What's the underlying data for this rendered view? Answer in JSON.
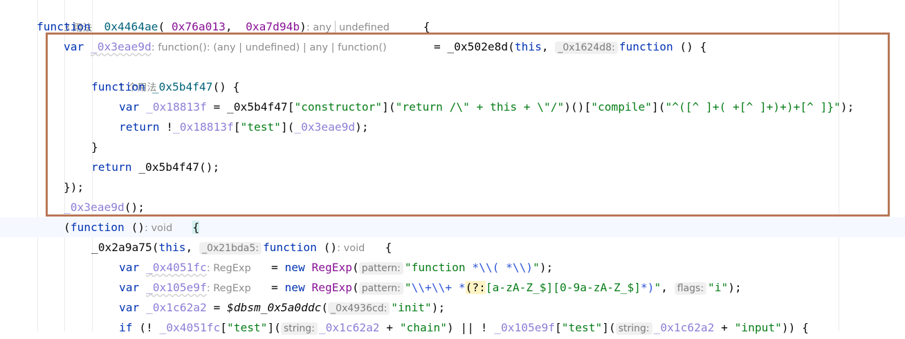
{
  "editor": {
    "usages_3": "3 用法",
    "usages_1": "1 个用法",
    "lines": {
      "l1": {
        "kw_function": "function",
        "name": "_0x4464ae",
        "paren_open": "(",
        "p1": "_0x76a013",
        "comma": ", ",
        "p2": "_0xa7d94b",
        "paren_close": ")",
        "hint_any": ": any",
        "hint_undefined": "undefined",
        "brace": "{"
      },
      "l2": {
        "kw_var": "var",
        "name": "_0x3eae9d",
        "type_hint": ": function(): (any | undefined) | any | function()",
        "eq_call": "= _0x502e8d(",
        "kw_this": "this",
        "comma": ", ",
        "param_hint": "_0x1624d8:",
        "kw_function": "function",
        "tail": " () {"
      },
      "l4": {
        "kw_function": "function",
        "name": " _0x5b4f47",
        "tail": "() {"
      },
      "l5": {
        "kw_var": "var",
        "name": "_0x18813f",
        "eq": " = ",
        "obj": "_0x5b4f47",
        "s1": "\"constructor\"",
        "s2": "\"return /\\\" + this + \\\"/\"",
        "mid": ")()[",
        "s3": "\"compile\"",
        "s4": "\"^([^ ]+( +[^ ]+)+)+[^ ]}\"",
        "end": ");"
      },
      "l6": {
        "kw_return": "return",
        "bang": " !",
        "obj": "_0x18813f",
        "s_test": "\"test\"",
        "arg": "_0x3eae9d",
        "end": ");"
      },
      "l7": {
        "brace": "}"
      },
      "l8": {
        "kw_return": "return",
        "call": " _0x5b4f47",
        "end": "();"
      },
      "l9": {
        "text": "});"
      },
      "l10": {
        "call": "_0x3eae9d",
        "end": "();"
      },
      "l11": {
        "open": "(",
        "kw_function": "function",
        "parens": " ()",
        "hint_void": ": void",
        "brace": "{"
      },
      "l12": {
        "call": "_0x2a9a75(",
        "kw_this": "this",
        "comma": ", ",
        "param_hint": "_0x21bda5:",
        "kw_function": "function",
        "parens": " ()",
        "hint_void": ": void",
        "brace": "{"
      },
      "l13": {
        "kw_var": "var",
        "name": "_0x4051fc",
        "type_hint": ": RegExp",
        "eq": "= ",
        "kw_new": "new",
        "cls": " RegExp",
        "open": "(",
        "param_hint": "pattern:",
        "s_a": "\"function ",
        "s_b": "*\\\\( *\\\\)",
        "s_c": "\"",
        "end": ");"
      },
      "l14": {
        "kw_var": "var",
        "name": "_0x105e9f",
        "type_hint": ": RegExp",
        "eq": "= ",
        "kw_new": "new",
        "cls": " RegExp",
        "open": "(",
        "param_hint": "pattern:",
        "s_a": "\"",
        "s_b": "\\\\+\\\\+ *",
        "s_c": "(?:",
        "s_d": "[a-zA-Z_$][0-9a-zA-Z_$]",
        "s_e": "*)",
        "s_f": "\"",
        "comma": ", ",
        "flags_hint": "flags:",
        "s_flags": "\"i\"",
        "end": ");"
      },
      "l15": {
        "kw_var": "var",
        "name": "_0x1c62a2",
        "eq": " = ",
        "call": "$dbsm_0x5a0ddc",
        "open": "(",
        "param_hint": "_0x4936cd:",
        "s_init": "\"init\"",
        "end": ");"
      },
      "l16": {
        "kw_if": "if",
        "open": " (! ",
        "obj1": "_0x4051fc",
        "s_test1": "\"test\"",
        "mid1": "](",
        "hint1": "string:",
        "v1": "_0x1c62a2",
        "plus1": " + ",
        "s_chain": "\"chain\"",
        "or": ") || ! ",
        "obj2": "_0x105e9f",
        "s_test2": "\"test\"",
        "mid2": "](",
        "hint2": "string:",
        "v2": "_0x1c62a2",
        "plus2": " + ",
        "s_input": "\"input\"",
        "end": ")) {"
      }
    }
  },
  "highlight_box_color": "#b87655"
}
